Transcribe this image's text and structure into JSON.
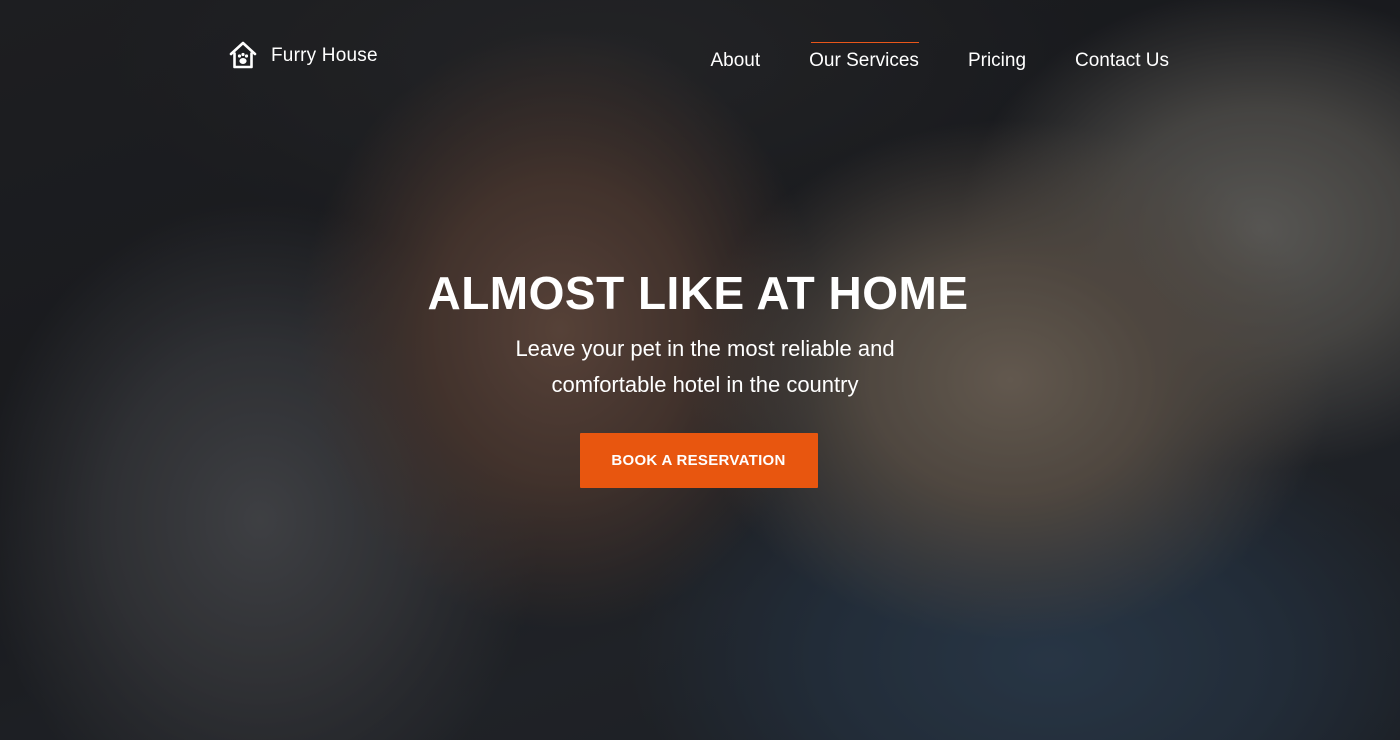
{
  "header": {
    "logo_text": "Furry House",
    "logo_icon": "house-paw-icon",
    "nav": [
      {
        "label": "About",
        "active": false
      },
      {
        "label": "Our Services",
        "active": true
      },
      {
        "label": "Pricing",
        "active": false
      },
      {
        "label": "Contact Us",
        "active": false
      }
    ]
  },
  "hero": {
    "title": "ALMOST LIKE AT HOME",
    "subtitle": "Leave your pet in the most reliable and comfortable hotel in the country",
    "cta_label": "BOOK A RESERVATION"
  },
  "colors": {
    "accent": "#e8560f",
    "text": "#ffffff"
  }
}
